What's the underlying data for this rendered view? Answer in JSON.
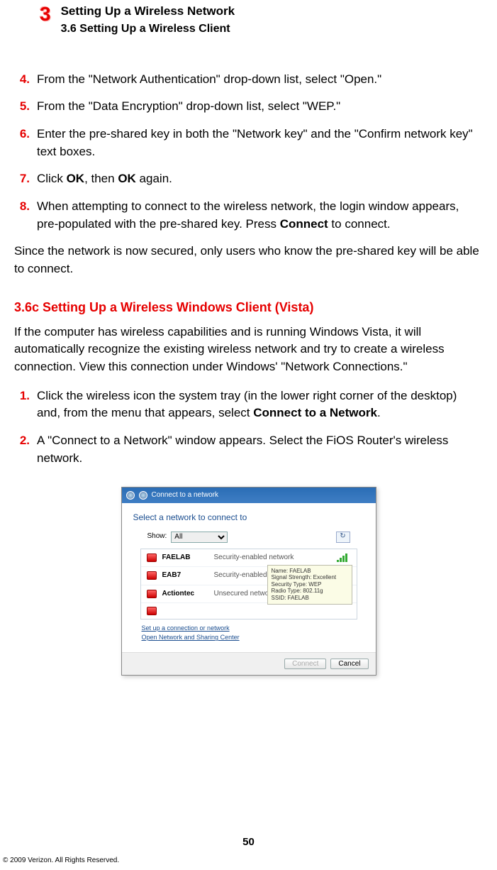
{
  "header": {
    "chapter_number": "3",
    "chapter_title": "Setting Up a Wireless Network",
    "section_title": "3.6  Setting Up a Wireless Client"
  },
  "steps_a": [
    {
      "num": "4.",
      "html": "From the \"Network Authentication\" drop-down list, select \"Open.\""
    },
    {
      "num": "5.",
      "html": "From the \"Data Encryption\" drop-down list, select \"WEP.\""
    },
    {
      "num": "6.",
      "html": "Enter the pre-shared key in both the \"Network key\" and the \"Confirm network key\" text boxes."
    },
    {
      "num": "7.",
      "html": "Click <b>OK</b>, then <b>OK</b> again."
    },
    {
      "num": "8.",
      "html": "When attempting to connect to the wireless network, the login window appears, pre-populated with the pre-shared key. Press <b>Connect</b> to connect."
    }
  ],
  "paragraph_after_a": "Since the network is now secured, only users who know the pre-shared key will be able to connect.",
  "sub_heading": "3.6c  Setting Up a Wireless Windows Client (Vista)",
  "paragraph_intro_b": "If the computer has wireless capabilities and is running Windows Vista, it will automatically recognize the existing wireless network and try to create a wireless connection. View this connection under Windows' \"Network Connections.\"",
  "steps_b": [
    {
      "num": "1.",
      "html": "Click the wireless icon the system tray (in the lower right corner of the desktop) and, from the menu that appears, select <b>Connect to a Network</b>."
    },
    {
      "num": "2.",
      "html": "A \"Connect to a Network\" window appears. Select the FiOS Router's wireless network."
    }
  ],
  "vista": {
    "title": "Connect to a network",
    "heading": "Select a network to connect to",
    "show_label": "Show:",
    "show_value": "All",
    "networks": [
      {
        "name": "FAELAB",
        "status": "Security-enabled network"
      },
      {
        "name": "EAB7",
        "status": "Security-enabled network"
      },
      {
        "name": "Actiontec",
        "status": "Unsecured network"
      }
    ],
    "tooltip": {
      "l1": "Name: FAELAB",
      "l2": "Signal Strength: Excellent",
      "l3": "Security Type: WEP",
      "l4": "Radio Type: 802.11g",
      "l5": "SSID: FAELAB"
    },
    "link1": "Set up a connection or network",
    "link2": "Open Network and Sharing Center",
    "btn_connect": "Connect",
    "btn_cancel": "Cancel"
  },
  "page_number": "50",
  "copyright": "© 2009 Verizon. All Rights Reserved."
}
